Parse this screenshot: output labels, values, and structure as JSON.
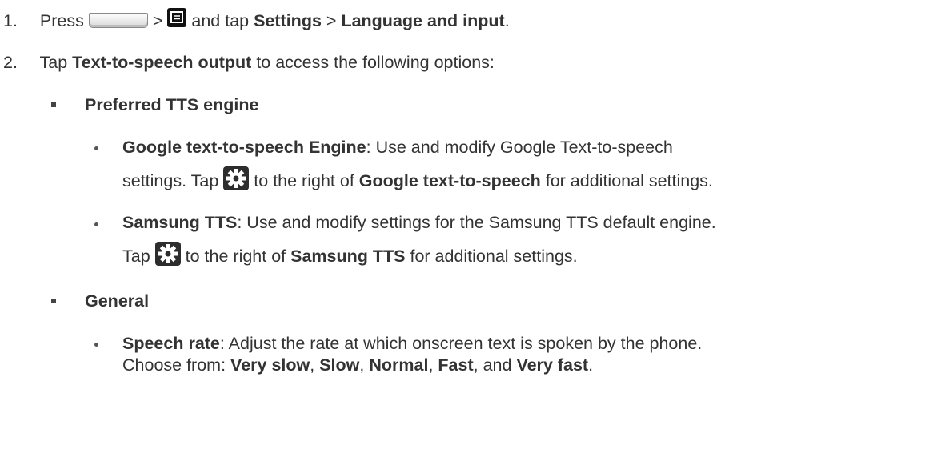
{
  "steps": [
    {
      "number": "1.",
      "press": "Press",
      "gt1": ">",
      "and_tap": "and tap",
      "settings": "Settings",
      "gt2": ">",
      "language_and_input": "Language and input",
      "period": "."
    },
    {
      "number": "2.",
      "tap": "Tap",
      "text_to_speech_output": "Text-to-speech output",
      "rest": "to access the following options:"
    }
  ],
  "sections": {
    "preferred_tts_engine": {
      "heading": "Preferred TTS engine",
      "google": {
        "term": "Google text-to-speech Engine",
        "desc": ": Use and modify Google Text-to-speech",
        "line2_start": "settings. Tap",
        "line2_mid": "to the right of",
        "line2_term": "Google text-to-speech",
        "line2_end": "for additional settings."
      },
      "samsung": {
        "term": "Samsung TTS",
        "desc": ": Use and modify settings for the Samsung TTS default engine.",
        "line2_start": "Tap",
        "line2_mid": "to the right of",
        "line2_term": "Samsung TTS",
        "line2_end": "for additional settings."
      }
    },
    "general": {
      "heading": "General",
      "speech_rate": {
        "term": "Speech rate",
        "desc": ": Adjust the rate at which onscreen text is spoken by the phone.",
        "line2_start": "Choose from:",
        "opt1": "Very slow",
        "comma1": ",",
        "opt2": "Slow",
        "comma2": ",",
        "opt3": "Normal",
        "comma3": ",",
        "opt4": "Fast",
        "and": ", and",
        "opt5": "Very fast",
        "period": "."
      }
    }
  },
  "icons": {
    "home_key": "home-key-icon",
    "menu_key": "menu-key-icon",
    "settings_gear": "gear-icon"
  }
}
